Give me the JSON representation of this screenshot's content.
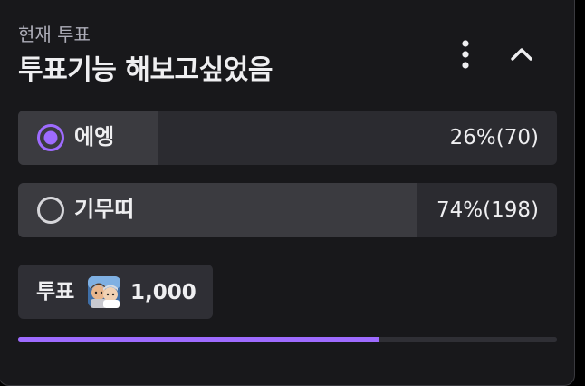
{
  "poll": {
    "subtitle": "현재 투표",
    "title": "투표기능 해보고싶었음",
    "options": [
      {
        "label": "에엥",
        "result": "26%(70)",
        "percent": 26,
        "votes": 70,
        "selected": true
      },
      {
        "label": "기무띠",
        "result": "74%(198)",
        "percent": 74,
        "votes": 198,
        "selected": false
      }
    ],
    "vote_button": {
      "label": "투표",
      "cost": "1,000",
      "emote": "channel-points-emote-icon"
    },
    "timer_progress": 0.67
  },
  "icons": {
    "menu": "more-vertical-icon",
    "collapse": "chevron-up-icon",
    "radio_selected": "radio-checked-icon",
    "radio_unselected": "radio-unchecked-icon"
  },
  "colors": {
    "accent": "#9e6bff",
    "panel_bg": "#18181b",
    "option_bg": "#2b2b30",
    "option_fill": "#3b3b40",
    "text": "#efeff1",
    "muted_text": "#adadb8"
  }
}
